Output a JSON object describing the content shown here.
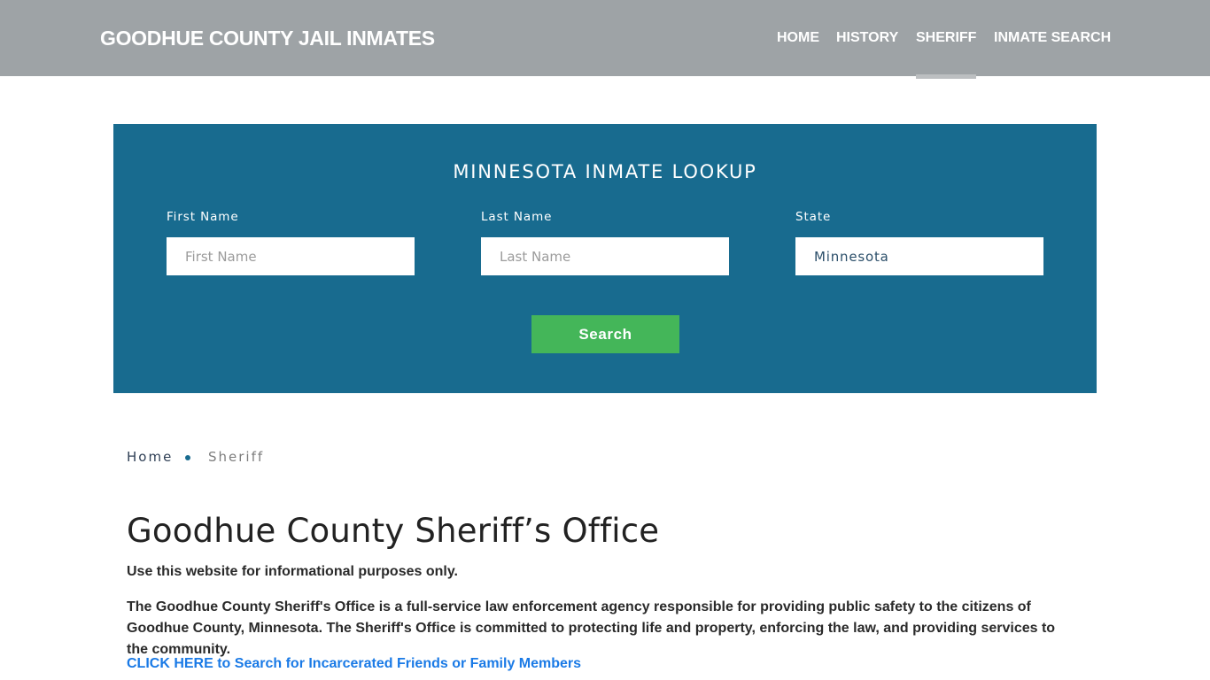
{
  "header": {
    "brand": "GOODHUE COUNTY JAIL INMATES",
    "nav": [
      {
        "label": "HOME",
        "active": false
      },
      {
        "label": "HISTORY",
        "active": false
      },
      {
        "label": "SHERIFF",
        "active": true
      },
      {
        "label": "INMATE SEARCH",
        "active": false
      }
    ]
  },
  "lookup": {
    "title": "MINNESOTA INMATE LOOKUP",
    "fields": [
      {
        "label": "First Name",
        "placeholder": "First Name",
        "value": ""
      },
      {
        "label": "Last Name",
        "placeholder": "Last Name",
        "value": ""
      },
      {
        "label": "State",
        "placeholder": "",
        "value": "Minnesota"
      }
    ],
    "search_label": "Search"
  },
  "breadcrumb": {
    "home": "Home",
    "current": "Sheriff"
  },
  "content": {
    "title": "Goodhue County Sheriff’s Office",
    "disclaimer": "Use this website for informational purposes only.",
    "description": "The Goodhue County Sheriff's Office is a full-service law enforcement agency responsible for providing public safety to the citizens of Goodhue County, Minnesota. The Sheriff's Office is committed to protecting life and property, enforcing the law, and providing services to the community.",
    "cta_link": "CLICK HERE to Search for Incarcerated Friends or Family Members"
  },
  "colors": {
    "header_bg": "#9ea3a6",
    "lookup_bg": "#186b8f",
    "search_button": "#44b659",
    "link": "#1a7ae6"
  }
}
